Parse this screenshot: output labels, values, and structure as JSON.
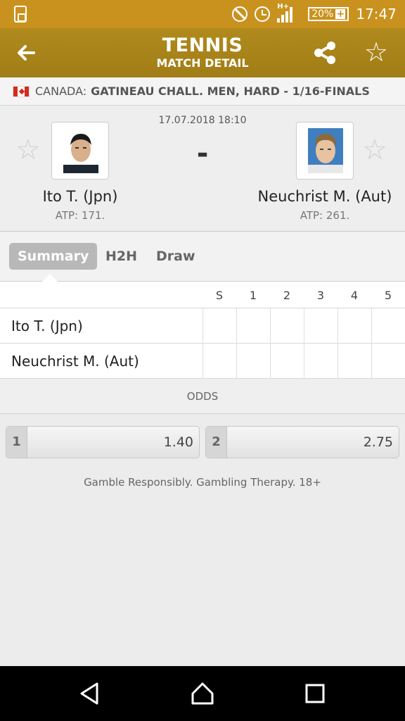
{
  "status_bar": {
    "network": "H+",
    "battery": "20%",
    "time": "17:47"
  },
  "app_bar": {
    "title": "TENNIS",
    "subtitle": "MATCH DETAIL"
  },
  "league": {
    "country": "CANADA:",
    "name": "GATINEAU CHALL. MEN, HARD - 1/16-FINALS"
  },
  "match": {
    "datetime": "17.07.2018 18:10",
    "score": "-",
    "home": {
      "name": "Ito T. (Jpn)",
      "rank": "ATP: 171."
    },
    "away": {
      "name": "Neuchrist M. (Aut)",
      "rank": "ATP: 261."
    }
  },
  "tabs": [
    "Summary",
    "H2H",
    "Draw"
  ],
  "score_table": {
    "columns": [
      "S",
      "1",
      "2",
      "3",
      "4",
      "5"
    ],
    "rows": [
      {
        "player": "Ito T. (Jpn)"
      },
      {
        "player": "Neuchrist M. (Aut)"
      }
    ]
  },
  "odds": {
    "header": "ODDS",
    "items": [
      {
        "label": "1",
        "value": "1.40"
      },
      {
        "label": "2",
        "value": "2.75"
      }
    ]
  },
  "disclaimer": "Gamble Responsibly. Gambling Therapy. 18+"
}
